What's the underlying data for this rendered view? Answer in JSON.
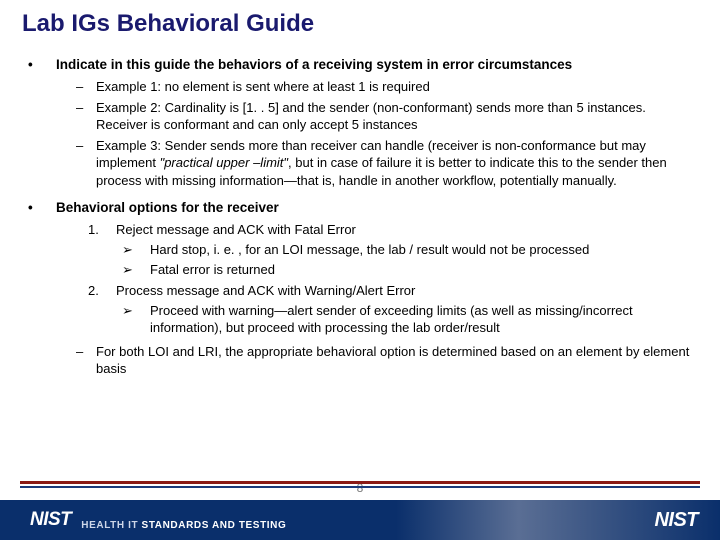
{
  "title": "Lab IGs Behavioral Guide",
  "section1": {
    "heading": "Indicate in this guide the behaviors of a receiving system in error circumstances",
    "ex1": "Example 1: no element is sent where at least 1 is required",
    "ex2": "Example 2: Cardinality is [1. . 5] and the sender (non-conformant) sends more than 5 instances. Receiver is conformant and can only accept 5 instances",
    "ex3_a": "Example 3: Sender sends more than receiver can handle (receiver is non-conformance but may implement ",
    "ex3_i": "\"practical upper –limit\"",
    "ex3_b": ", but in case of failure it is better to indicate this to the sender then process with missing information—that is, handle in another workflow, potentially manually."
  },
  "section2": {
    "heading": "Behavioral options for the receiver",
    "opt1": {
      "num": "1.",
      "text": "Reject message and ACK with Fatal Error",
      "a": "Hard stop, i. e. , for an LOI message, the lab / result would not be processed",
      "b": "Fatal error is returned"
    },
    "opt2": {
      "num": "2.",
      "text": "Process message and ACK with Warning/Alert Error",
      "a": "Proceed with warning—alert sender of exceeding limits (as well as missing/incorrect information), but proceed with processing the lab order/result"
    },
    "note": "For both LOI and LRI, the appropriate behavioral option is determined based on an element by element basis"
  },
  "footer": {
    "nist": "NIST",
    "tag_plain": "HEALTH IT ",
    "tag_white": "STANDARDS AND TESTING"
  },
  "page": "8",
  "glyphs": {
    "bullet": "•",
    "dash": "–",
    "arrow": "➢"
  }
}
